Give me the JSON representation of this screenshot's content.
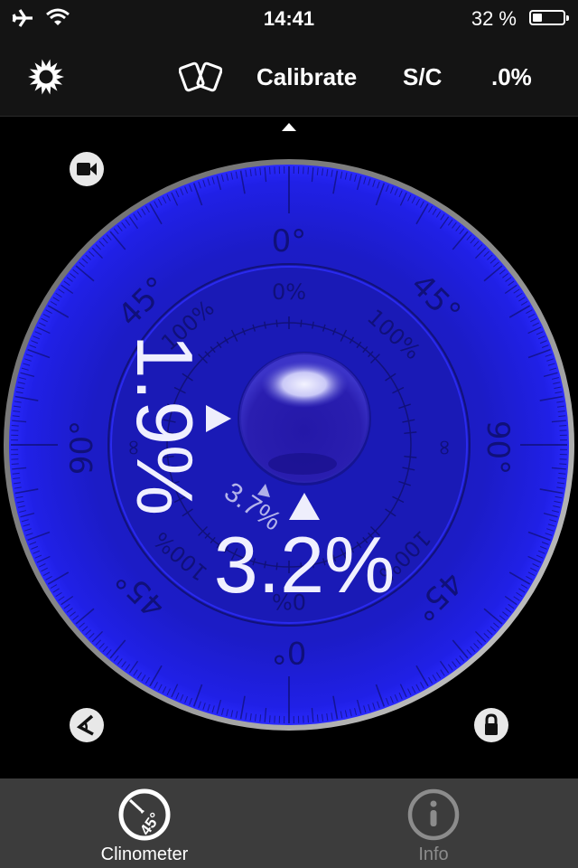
{
  "status_bar": {
    "time": "14:41",
    "battery_percent_label": "32 %",
    "battery_level": 0.32,
    "icons": [
      "airplane-icon",
      "wifi-icon",
      "battery-icon"
    ]
  },
  "toolbar": {
    "settings_icon": "sun-icon",
    "flip_icon": "cards-icon",
    "calibrate_label": "Calibrate",
    "sc_label": "S/C",
    "precision_label": ".0%"
  },
  "dial": {
    "colors": {
      "face": "#1c1ccf",
      "face_edge": "#2a2aff",
      "bezel": "#9a9a9a",
      "marking": "#10107a",
      "readout": "#f0f0ff"
    },
    "outer_labels": {
      "top": "0°",
      "right": "90°",
      "bottom": "0°",
      "left": "90°",
      "top_left": "45°",
      "top_right": "45°",
      "bottom_left": "45°",
      "bottom_right": "45°"
    },
    "inner_labels": {
      "top": "0%",
      "top_left": "100%",
      "top_right": "100%",
      "bottom": "0%",
      "bottom_left": "100%",
      "bottom_right": "100%",
      "left": "∞",
      "right": "∞"
    },
    "side_reading": "1.9%",
    "main_reading": "3.2%",
    "secondary_reading": "3.7%"
  },
  "controls": {
    "camera_icon": "video-camera-icon",
    "angle_icon": "angle-icon",
    "lock_icon": "lock-icon"
  },
  "tabs": [
    {
      "label": "Clinometer",
      "icon": "clinometer-45-icon",
      "active": true,
      "icon_text": "45°"
    },
    {
      "label": "Info",
      "icon": "info-icon",
      "active": false
    }
  ]
}
